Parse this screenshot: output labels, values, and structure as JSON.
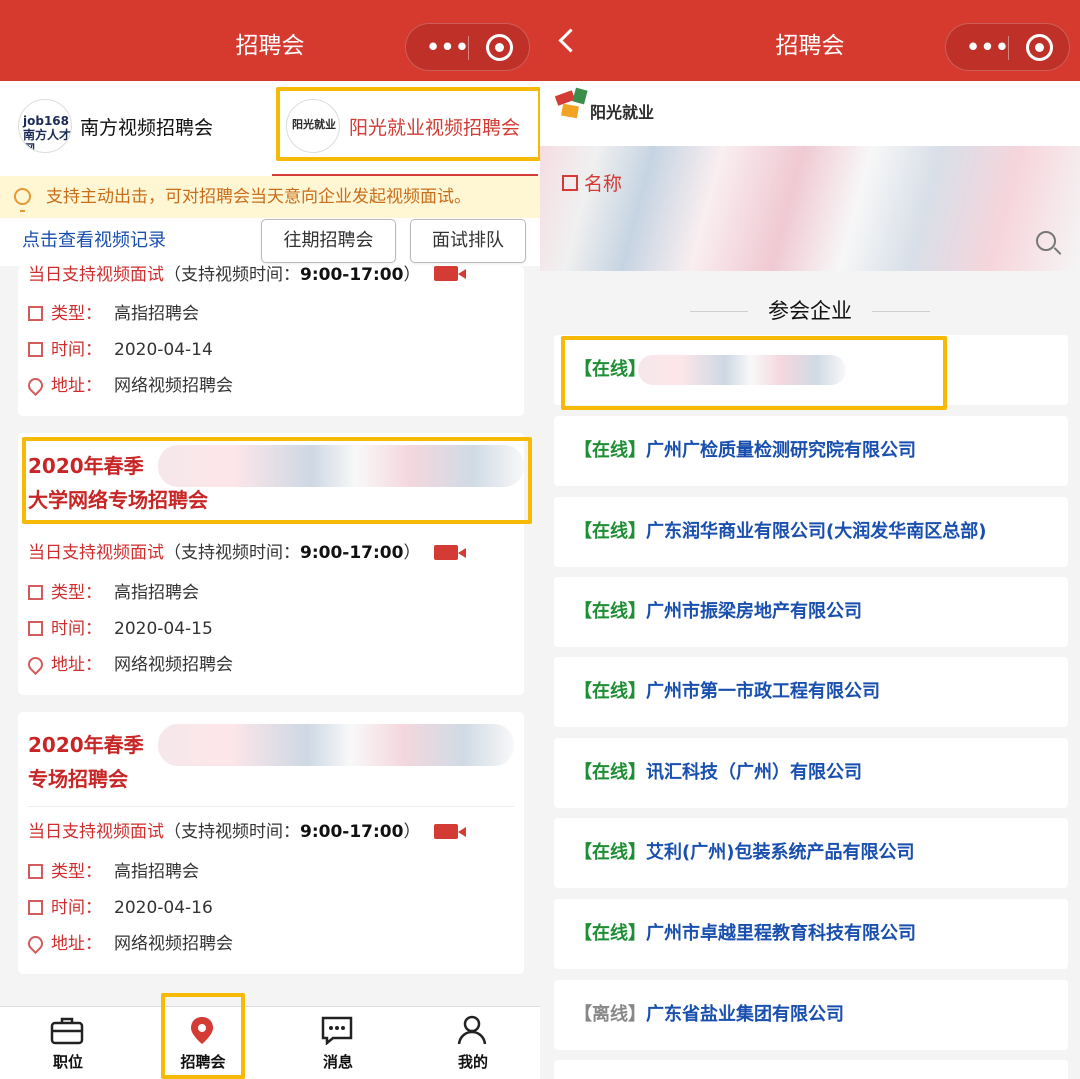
{
  "left": {
    "nav_title": "招聘会",
    "tabs": [
      {
        "logo_text": "job168 南方人才网",
        "label": "南方视频招聘会"
      },
      {
        "logo_text": "阳光就业",
        "label": "阳光就业视频招聘会"
      }
    ],
    "notice": "支持主动出击，可对招聘会当天意向企业发起视频面试。",
    "record_link": "点击查看视频记录",
    "buttons": [
      "往期招聘会",
      "面试排队"
    ],
    "cards": [
      {
        "support": "当日支持视频面试",
        "support_detail": "（支持视频时间：",
        "time_range": "9:00-17:00",
        "close_paren": "）",
        "type_label": "类型：",
        "type_value": "高指招聘会",
        "date_label": "时间：",
        "date_value": "2020-04-14",
        "address_label": "地址：",
        "address_value": "网络视频招聘会"
      },
      {
        "title_line1": "2020年春季",
        "title_line2": "大学网络专场招聘会",
        "support": "当日支持视频面试",
        "support_detail": "（支持视频时间：",
        "time_range": "9:00-17:00",
        "close_paren": "）",
        "type_label": "类型：",
        "type_value": "高指招聘会",
        "date_label": "时间：",
        "date_value": "2020-04-15",
        "address_label": "地址：",
        "address_value": "网络视频招聘会"
      },
      {
        "title_line1": "2020年春季",
        "title_line2": "专场招聘会",
        "support": "当日支持视频面试",
        "support_detail": "（支持视频时间：",
        "time_range": "9:00-17:00",
        "close_paren": "）",
        "type_label": "类型：",
        "type_value": "高指招聘会",
        "date_label": "时间：",
        "date_value": "2020-04-16",
        "address_label": "地址：",
        "address_value": "网络视频招聘会"
      }
    ],
    "bottom_nav": [
      {
        "label": "职位",
        "icon": "briefcase-icon"
      },
      {
        "label": "招聘会",
        "icon": "location-pin-icon"
      },
      {
        "label": "消息",
        "icon": "chat-icon"
      },
      {
        "label": "我的",
        "icon": "user-icon"
      }
    ]
  },
  "right": {
    "nav_title": "招聘会",
    "logo_text": "阳光就业",
    "name_label": "名称",
    "section_title": "参会企业",
    "companies": [
      {
        "status": "【在线】",
        "name": ""
      },
      {
        "status": "【在线】",
        "name": "广州广检质量检测研究院有限公司"
      },
      {
        "status": "【在线】",
        "name": "广东润华商业有限公司(大润发华南区总部)"
      },
      {
        "status": "【在线】",
        "name": "广州市振梁房地产有限公司"
      },
      {
        "status": "【在线】",
        "name": "广州市第一市政工程有限公司"
      },
      {
        "status": "【在线】",
        "name": "讯汇科技（广州）有限公司"
      },
      {
        "status": "【在线】",
        "name": "艾利(广州)包装系统产品有限公司"
      },
      {
        "status": "【在线】",
        "name": "广州市卓越里程教育科技有限公司"
      },
      {
        "status": "【离线】",
        "name": "广东省盐业集团有限公司"
      }
    ]
  },
  "colors": {
    "brand_red": "#d63a2f",
    "highlight": "#f6b905",
    "link_blue": "#194fae",
    "online_green": "#1e8e34",
    "offline_gray": "#888888"
  }
}
